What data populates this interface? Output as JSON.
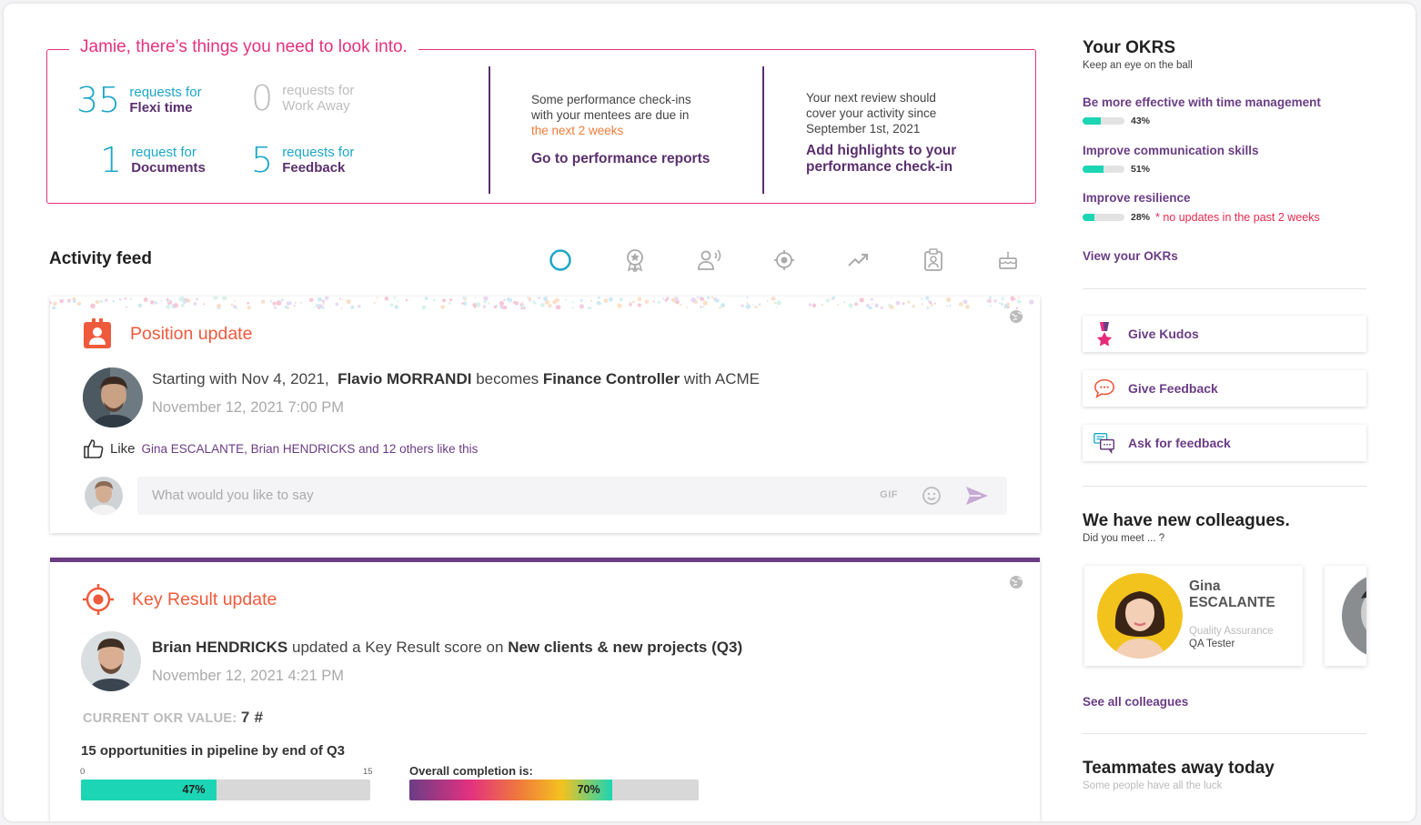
{
  "alert": {
    "title": "Jamie, there’s things you need to look into.",
    "stats": [
      {
        "num": "35",
        "line1": "requests for",
        "line2": "Flexi time",
        "muted": false
      },
      {
        "num": "0",
        "line1": "requests for",
        "line2": "Work Away",
        "muted": true
      },
      {
        "num": "1",
        "line1": "request for",
        "line2": "Documents",
        "muted": false
      },
      {
        "num": "5",
        "line1": "requests for",
        "line2": "Feedback",
        "muted": false
      }
    ],
    "checkins": {
      "line1": "Some performance check-ins",
      "line2": "with your mentees are due in",
      "highlight": "the next 2 weeks",
      "link": "Go to performance reports"
    },
    "review": {
      "line1": "Your next review should",
      "line2": "cover your activity since",
      "line3": "September 1st, 2021",
      "link1": "Add highlights to your",
      "link2": "performance check-in"
    }
  },
  "feed": {
    "title": "Activity feed",
    "filter_icons": [
      "all-circle-icon",
      "award-icon",
      "voice-user-icon",
      "target-icon",
      "trend-up-icon",
      "clipboard-user-icon",
      "cake-icon"
    ]
  },
  "post1": {
    "type": "Position update",
    "text_pre": "Starting with Nov 4, 2021,",
    "person": "Flavio MORRANDI",
    "text_mid": "becomes",
    "position": "Finance Controller",
    "text_post": "with ACME",
    "time": "November 12, 2021  7:00 PM",
    "like_label": "Like",
    "likers": "Gina ESCALANTE, Brian HENDRICKS and 12 others like this",
    "comment_placeholder": "What would you like to say",
    "gif_label": "GIF"
  },
  "post2": {
    "type": "Key Result update",
    "person": "Brian HENDRICKS",
    "text_mid": "updated a Key Result score on",
    "target": "New clients & new projects (Q3)",
    "time": "November 12, 2021  4:21 PM",
    "okr_label": "CURRENT OKR VALUE:",
    "okr_value": "7 #",
    "goal": "15 opportunities in pipeline by end of Q3",
    "scale_min": "0",
    "scale_max": "15",
    "progress_label": "47%",
    "progress": 0.47,
    "overall_label": "Overall completion is:",
    "overall_pct_label": "70%",
    "overall": 0.7
  },
  "okrs": {
    "title": "Your OKRS",
    "subtitle": "Keep an eye on the ball",
    "items": [
      {
        "name": "Be more effective with time management",
        "pct": "43%",
        "value": 0.43,
        "warning": ""
      },
      {
        "name": "Improve communication skills",
        "pct": "51%",
        "value": 0.51,
        "warning": ""
      },
      {
        "name": "Improve resilience",
        "pct": "28%",
        "value": 0.28,
        "warning": "* no updates in the past 2 weeks"
      }
    ],
    "view_link": "View your OKRs"
  },
  "actions": [
    {
      "label": "Give Kudos",
      "icon": "kudos-medal-icon"
    },
    {
      "label": "Give Feedback",
      "icon": "feedback-bubble-icon"
    },
    {
      "label": "Ask for feedback",
      "icon": "ask-feedback-chat-icon"
    }
  ],
  "colleagues": {
    "title": "We have new colleagues.",
    "subtitle": "Did you meet ... ?",
    "card": {
      "first": "Gina",
      "last": "ESCALANTE",
      "dept": "Quality Assurance",
      "role": "QA Tester"
    },
    "see_all": "See all colleagues"
  },
  "away": {
    "title": "Teammates away today",
    "subtitle": "Some people have all the luck"
  },
  "colors": {
    "magenta": "#e3317f",
    "teal": "#1da7c7",
    "purple": "#5a2f6e",
    "orange": "#ef5a3c",
    "green": "#1cd5b4"
  }
}
